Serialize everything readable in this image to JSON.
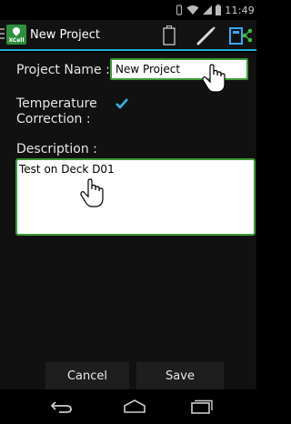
{
  "status_bar": {
    "time": "11:49",
    "icons": [
      "vibrate-icon",
      "wifi-icon",
      "signal-icon",
      "battery-icon"
    ]
  },
  "action_bar": {
    "app_logo_text": "XCell",
    "title": "New Project",
    "actions": [
      "battery-status-icon",
      "edit-pen-icon",
      "share-icon"
    ],
    "accent_color": "#1fb1d6"
  },
  "form": {
    "project_name_label": "Project Name :",
    "project_name_value": "New Project",
    "temperature_label_line1": "Temperature",
    "temperature_label_line2": "Correction :",
    "temperature_checked": true,
    "description_label": "Description :",
    "description_value": "Test on Deck D01",
    "field_border_color": "#3d9a37"
  },
  "buttons": {
    "cancel": "Cancel",
    "save": "Save"
  },
  "nav_bar": {
    "buttons": [
      "back-icon",
      "home-icon",
      "recents-icon"
    ]
  }
}
